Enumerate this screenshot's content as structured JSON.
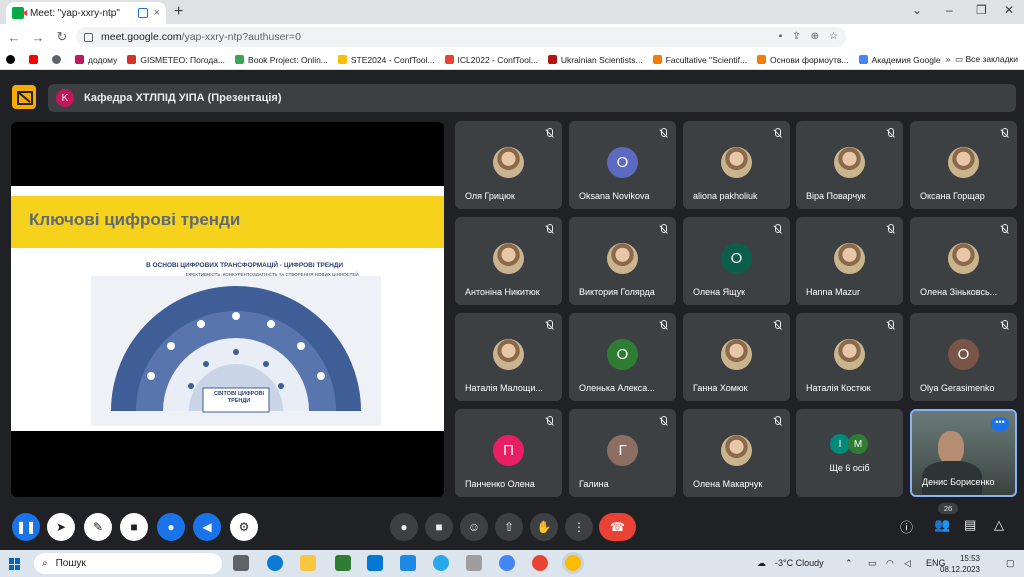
{
  "browser": {
    "tab_title": "Meet: \"yap-xxry-ntp\"",
    "tab_close": "×",
    "new_tab": "+",
    "url_host": "meet.google.com",
    "url_path": "/yap-xxry-ntp?authuser=0",
    "bookmarks": [
      {
        "label": "додому",
        "color": "#c2185b"
      },
      {
        "label": "GISMETEO: Погода...",
        "color": "#d93025"
      },
      {
        "label": "Book Project: Onlin...",
        "color": "#34a853"
      },
      {
        "label": "STE2024 - ConfTool...",
        "color": "#fbbc04"
      },
      {
        "label": "ICL2022 - ConfTool...",
        "color": "#ea4335"
      },
      {
        "label": "Ukrainian Scientists...",
        "color": "#b31412"
      },
      {
        "label": "Facultative \"Scientif...",
        "color": "#f57c00"
      },
      {
        "label": "Основи формоутв...",
        "color": "#f57c00"
      },
      {
        "label": "Академия Google",
        "color": "#4285f4"
      }
    ],
    "all_bookmarks": "Все закладки"
  },
  "meet": {
    "avatar_letter": "K",
    "avatar_color": "#c2185b",
    "meeting_title": "Кафедра ХТЛПІД УІПА (Презентація)",
    "slide": {
      "title": "Ключові цифрові тренди",
      "subtitle": "В ОСНОВІ ЦИФРОВИХ ТРАНСФОРМАЦІЙ - ЦИФРОВІ ТРЕНДИ",
      "subtitle2": "ЕФЕКТИВНІСТЬ, КОНКУРЕНТОЗДАТНІСТЬ ТА СТВОРЕННЯ НОВИХ ЦІННОСТЕЙ",
      "center_label": "СВІТОВІ ЦИФРОВІ ТРЕНДИ"
    },
    "participants": [
      {
        "name": "Оля Грицюк",
        "type": "photo"
      },
      {
        "name": "Oksana Novikova",
        "type": "letter",
        "letter": "O",
        "color": "#5c6bc0"
      },
      {
        "name": "aliona pakholiuk",
        "type": "photo"
      },
      {
        "name": "Віра Поварчук",
        "type": "photo"
      },
      {
        "name": "Оксана Горщар",
        "type": "photo"
      },
      {
        "name": "Антоніна Никитюк",
        "type": "photo"
      },
      {
        "name": "Виктория Голярда",
        "type": "photo"
      },
      {
        "name": "Олена Ящук",
        "type": "letter",
        "letter": "O",
        "color": "#0b5f4a"
      },
      {
        "name": "Нanna Mazur",
        "type": "photo"
      },
      {
        "name": "Олена Зіньковсь...",
        "type": "photo"
      },
      {
        "name": "Наталія Малощи...",
        "type": "photo"
      },
      {
        "name": "Оленька Алекса...",
        "type": "letter",
        "letter": "O",
        "color": "#2e7d32"
      },
      {
        "name": "Ганна Хомюк",
        "type": "photo"
      },
      {
        "name": "Наталія Костюк",
        "type": "photo"
      },
      {
        "name": "Olya Gerasimenko",
        "type": "letter",
        "letter": "O",
        "color": "#795548"
      },
      {
        "name": "Панченко Олена",
        "type": "letter",
        "letter": "П",
        "color": "#e91e63"
      },
      {
        "name": "Галина",
        "type": "letter",
        "letter": "Г",
        "color": "#8d6e63"
      },
      {
        "name": "Олена Макарчук",
        "type": "photo"
      }
    ],
    "others": {
      "label": "Ще 6 осіб",
      "letters": [
        "І",
        "М"
      ],
      "colors": [
        "#00897b",
        "#2e7d32"
      ]
    },
    "active_speaker": "Денис Борисенко",
    "participant_count": "26"
  },
  "taskbar": {
    "search_placeholder": "Пошук",
    "weather": "-3°C Cloudy",
    "lang": "ENG",
    "time": "15:53",
    "date": "08.12.2023"
  }
}
